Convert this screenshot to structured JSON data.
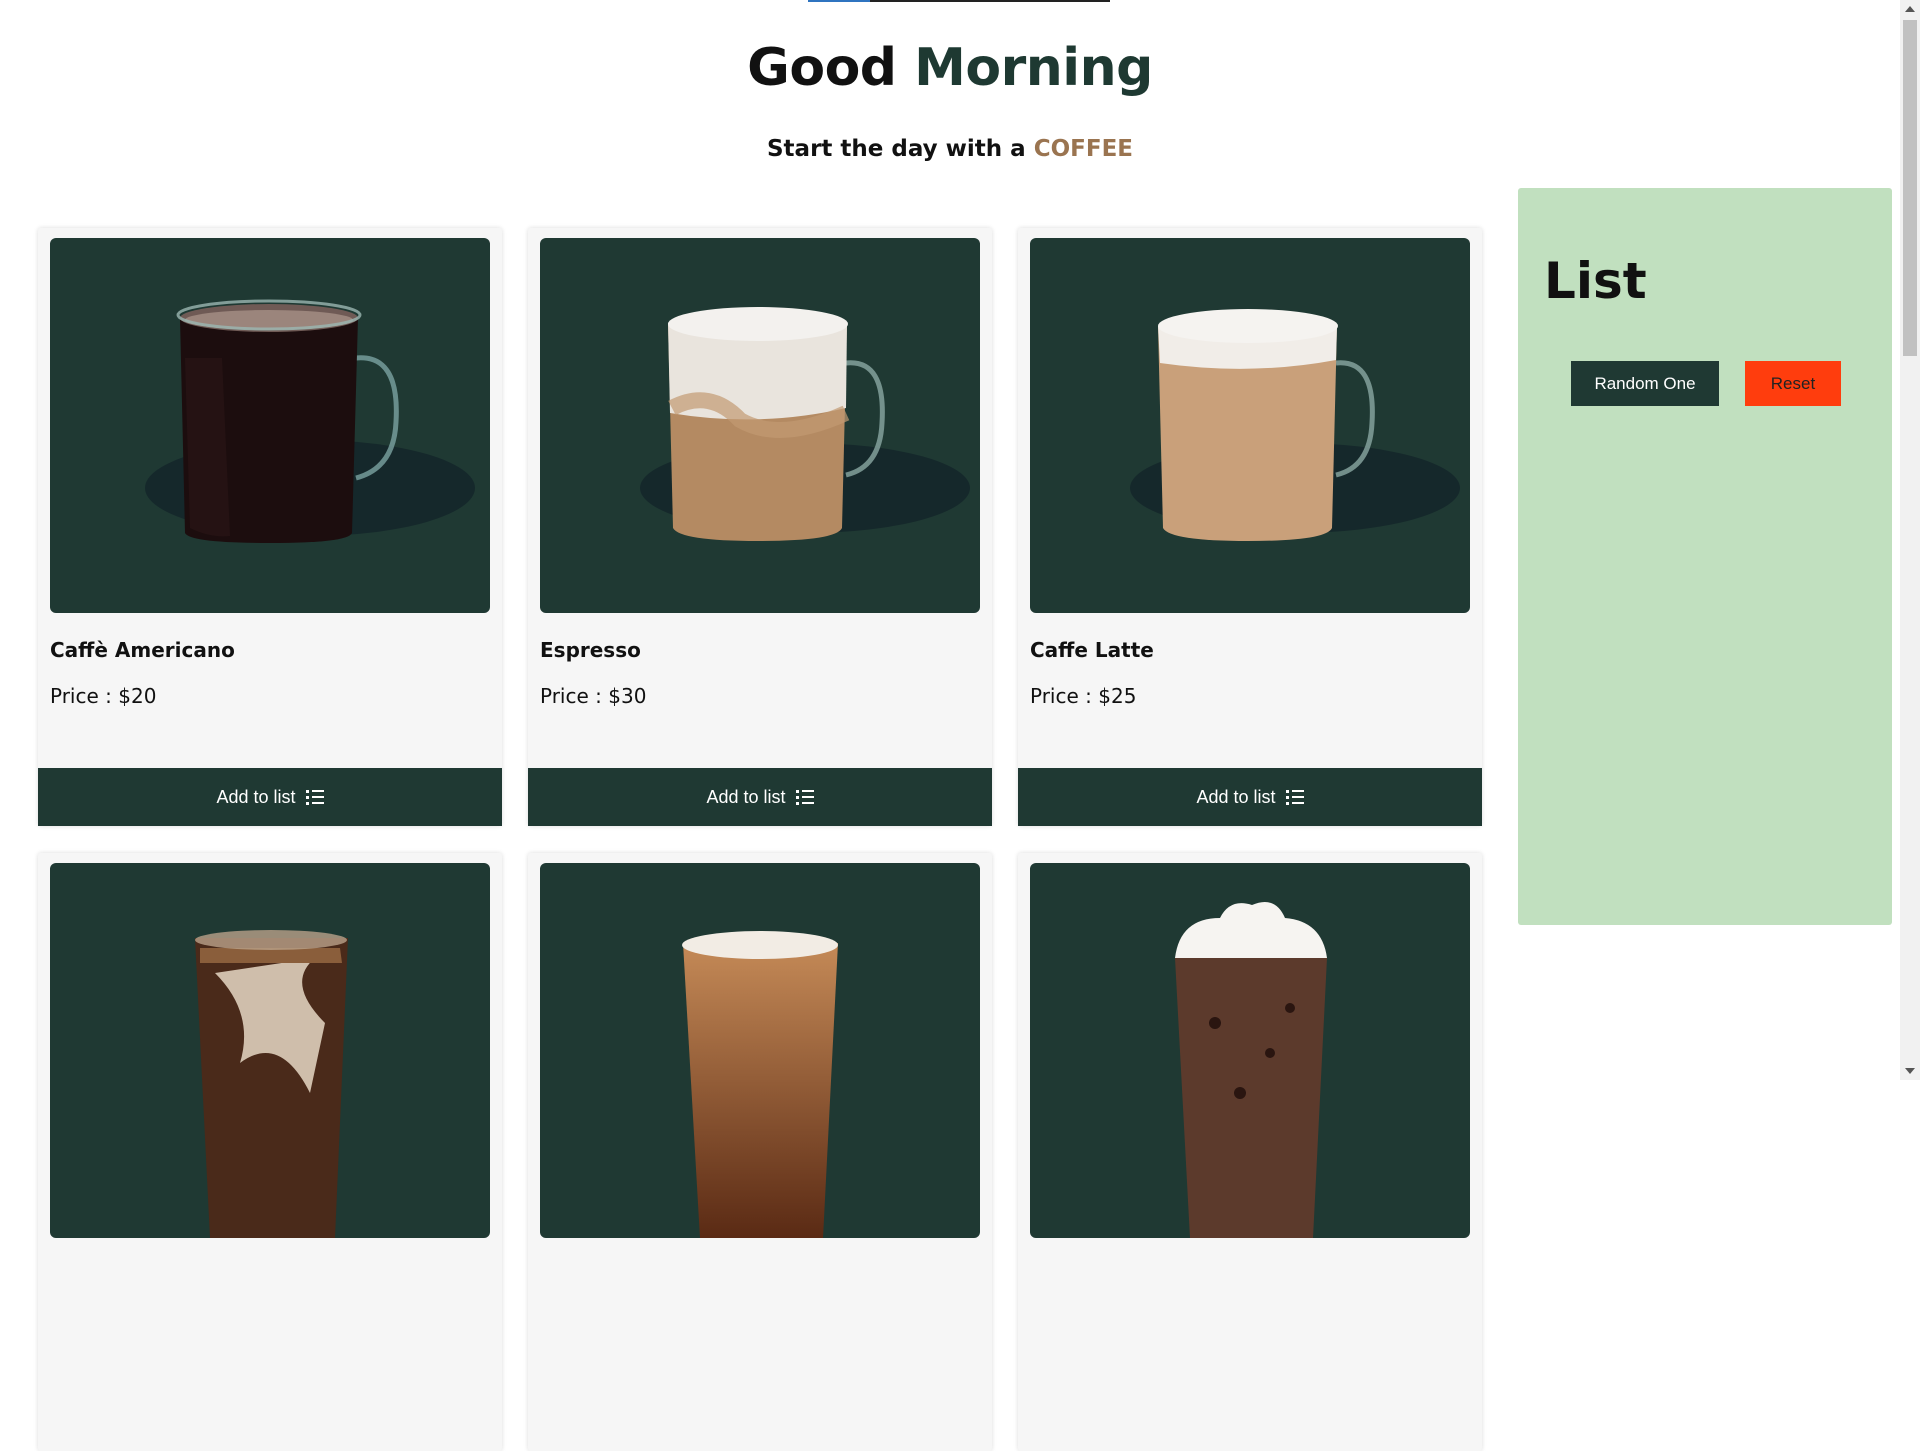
{
  "header": {
    "greeting_word": "Good",
    "greeting_highlight": "Morning",
    "tagline_prefix": "Start the day with a",
    "tagline_highlight": "COFFEE"
  },
  "products": [
    {
      "name": "Caffè Americano",
      "price_label": "Price : $20",
      "button_label": "Add to list",
      "image": "caffe-americano-glass-mug"
    },
    {
      "name": "Espresso",
      "price_label": "Price : $30",
      "button_label": "Add to list",
      "image": "espresso-glass-mug"
    },
    {
      "name": "Caffe Latte",
      "price_label": "Price : $25",
      "button_label": "Add to list",
      "image": "caffe-latte-glass-mug"
    },
    {
      "name": "",
      "price_label": "",
      "button_label": "",
      "image": "iced-coffee-cup"
    },
    {
      "name": "",
      "price_label": "",
      "button_label": "",
      "image": "cold-brew-cup"
    },
    {
      "name": "",
      "price_label": "",
      "button_label": "",
      "image": "iced-mocha-whipped-cream"
    }
  ],
  "sidebar": {
    "title": "List",
    "random_label": "Random One",
    "reset_label": "Reset"
  },
  "colors": {
    "brand_green": "#1f3933",
    "panel_green": "#c1e0bf",
    "reset_red": "#ff3d0d",
    "coffee_brown": "#9a7450"
  },
  "icons": {
    "add_to_list": "list-icon"
  }
}
